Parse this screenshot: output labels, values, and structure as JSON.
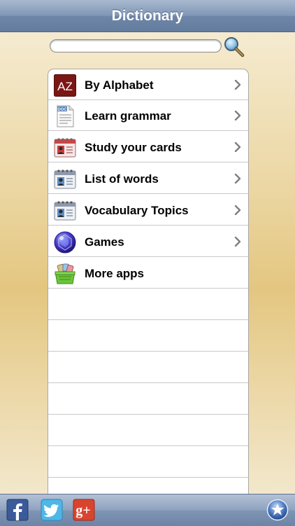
{
  "navbar": {
    "title": "Dictionary"
  },
  "search": {
    "value": "",
    "placeholder": ""
  },
  "menu": {
    "items": [
      {
        "label": "By Alphabet",
        "icon": "az-alphabet-icon",
        "has_chevron": true
      },
      {
        "label": "Learn grammar",
        "icon": "document-icon",
        "has_chevron": true
      },
      {
        "label": "Study your cards",
        "icon": "flashcards-red-icon",
        "has_chevron": true
      },
      {
        "label": "List of words",
        "icon": "contact-card-icon",
        "has_chevron": true
      },
      {
        "label": "Vocabulary Topics",
        "icon": "contact-card-icon",
        "has_chevron": true
      },
      {
        "label": "Games",
        "icon": "gem-icon",
        "has_chevron": true
      },
      {
        "label": "More apps",
        "icon": "basket-icon",
        "has_chevron": false
      }
    ]
  },
  "toolbar": {
    "buttons": [
      "facebook-icon",
      "twitter-icon",
      "google-plus-icon",
      "star-badge-icon"
    ]
  },
  "icon_text": {
    "az": "AZ",
    "doc": "DOC",
    "gplus": "g+"
  }
}
